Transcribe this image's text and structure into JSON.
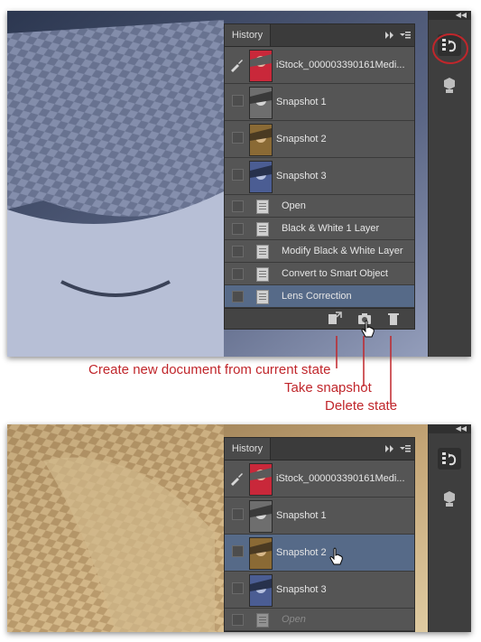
{
  "panels": [
    {
      "tab": "History",
      "source_snapshot": "iStock_000003390161Medi...",
      "snapshots": [
        "Snapshot 1",
        "Snapshot 2",
        "Snapshot 3"
      ],
      "states": [
        "Open",
        "Black & White 1 Layer",
        "Modify Black & White Layer",
        "Convert to Smart Object",
        "Lens Correction"
      ],
      "selected_state": "Lens Correction"
    },
    {
      "tab": "History",
      "source_snapshot": "iStock_000003390161Medi...",
      "snapshots": [
        "Snapshot 1",
        "Snapshot 2",
        "Snapshot 3"
      ],
      "states": [
        "Open"
      ],
      "selected_snapshot": "Snapshot 2"
    }
  ],
  "callouts": {
    "new_document": "Create new document from current state",
    "take_snapshot": "Take snapshot",
    "delete_state": "Delete state"
  },
  "icons": [
    "history-brush-icon",
    "new-document-icon",
    "camera-icon",
    "trash-icon",
    "panel-menu-icon",
    "collapse-arrows-icon",
    "history-panel-icon",
    "3d-panel-icon",
    "hand-cursor-icon"
  ],
  "colors": {
    "callout_red": "#c0262b",
    "selection_blue": "#566a88",
    "panel_gray": "#4a4a4a"
  }
}
